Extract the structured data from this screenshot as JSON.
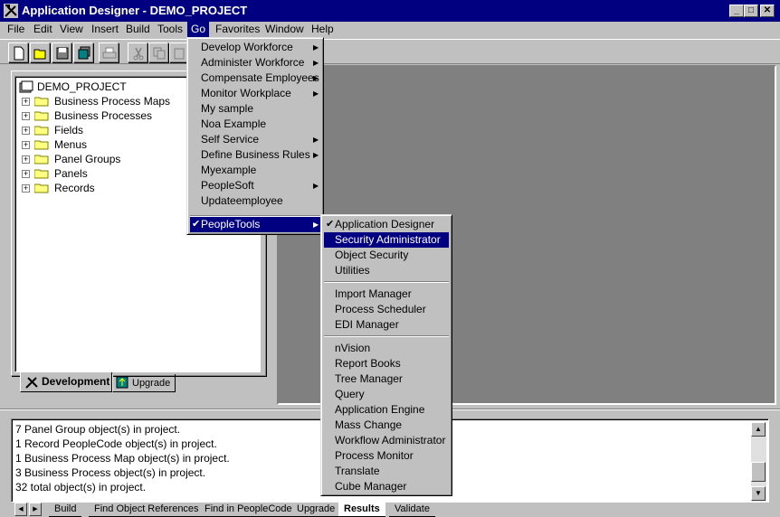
{
  "window": {
    "title": "Application Designer - DEMO_PROJECT",
    "minimize": "_",
    "maximize": "□",
    "close": "✕"
  },
  "menubar": [
    "File",
    "Edit",
    "View",
    "Insert",
    "Build",
    "Tools",
    "Go",
    "Favorites",
    "Window",
    "Help"
  ],
  "menubar_active": "Go",
  "toolbar_icons": [
    "new-icon",
    "open-icon",
    "save-icon",
    "save-all-icon",
    "print-icon",
    "cut-icon",
    "copy-icon",
    "paste-icon"
  ],
  "tree": {
    "root": "DEMO_PROJECT",
    "items": [
      "Business Process Maps",
      "Business Processes",
      "Fields",
      "Menus",
      "Panel Groups",
      "Panels",
      "Records"
    ]
  },
  "tabs": {
    "development": "Development",
    "upgrade": "Upgrade"
  },
  "go_menu": {
    "items": [
      {
        "label": "Develop Workforce",
        "submenu": true
      },
      {
        "label": "Administer Workforce",
        "submenu": true
      },
      {
        "label": "Compensate Employees",
        "submenu": true
      },
      {
        "label": "Monitor Workplace",
        "submenu": true
      },
      {
        "label": "My sample",
        "submenu": false
      },
      {
        "label": "Noa Example",
        "submenu": false
      },
      {
        "label": "Self Service",
        "submenu": true
      },
      {
        "label": "Define Business Rules",
        "submenu": true
      },
      {
        "label": "Myexample",
        "submenu": false
      },
      {
        "label": "PeopleSoft",
        "submenu": true
      },
      {
        "label": "Updateemployee",
        "submenu": false
      }
    ],
    "peopletools": "PeopleTools",
    "check_mark": "✔",
    "arrow": "▶"
  },
  "peopletools_menu": {
    "group1": [
      "Application Designer",
      "Security Administrator",
      "Object Security",
      "Utilities"
    ],
    "group2": [
      "Import Manager",
      "Process Scheduler",
      "EDI Manager"
    ],
    "group3": [
      "nVision",
      "Report Books",
      "Tree Manager",
      "Query",
      "Application Engine",
      "Mass Change",
      "Workflow Administrator",
      "Process Monitor",
      "Translate",
      "Cube Manager"
    ],
    "checked": "Application Designer",
    "highlighted": "Security Administrator"
  },
  "output": {
    "lines": [
      "7 Panel Group  object(s) in project.",
      "1 Record PeopleCode  object(s) in project.",
      "1 Business Process Map  object(s) in project.",
      "3 Business Process  object(s) in project.",
      "32  total object(s) in project."
    ]
  },
  "bottom_tabs": [
    "Build",
    "Find Object References",
    "Find in PeopleCode",
    "Upgrade",
    "Results",
    "Validate"
  ],
  "bottom_tab_selected": "Results",
  "scroll": {
    "up": "▲",
    "down": "▼",
    "left": "◀",
    "right": "▶"
  }
}
